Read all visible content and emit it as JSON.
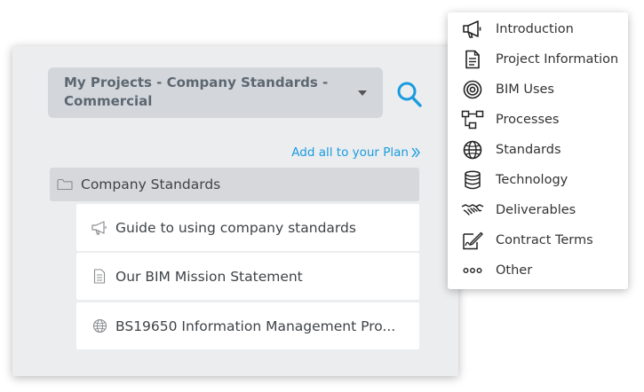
{
  "project_selector": {
    "value": "My Projects - Company Standards - Commercial"
  },
  "actions": {
    "add_all_label": "Add all to your Plan"
  },
  "folder": {
    "label": "Company Standards",
    "items": [
      {
        "label": "Guide to using company standards",
        "icon": "megaphone-icon"
      },
      {
        "label": "Our BIM Mission Statement",
        "icon": "document-icon"
      },
      {
        "label": "BS19650 Information Management Pro...",
        "icon": "globe-icon"
      }
    ]
  },
  "category_menu": {
    "items": [
      {
        "label": "Introduction",
        "icon": "megaphone-icon"
      },
      {
        "label": "Project Information",
        "icon": "document-icon"
      },
      {
        "label": "BIM Uses",
        "icon": "target-icon"
      },
      {
        "label": "Processes",
        "icon": "flowchart-icon"
      },
      {
        "label": "Standards",
        "icon": "globe-icon"
      },
      {
        "label": "Technology",
        "icon": "database-icon"
      },
      {
        "label": "Deliverables",
        "icon": "handshake-icon"
      },
      {
        "label": "Contract Terms",
        "icon": "signature-icon"
      },
      {
        "label": "Other",
        "icon": "ellipsis-icon"
      }
    ]
  },
  "colors": {
    "accent": "#1a9be0",
    "panel_background": "#ebedef",
    "selector_background": "#d3d7dc",
    "folder_row_background": "#d7d8db"
  }
}
